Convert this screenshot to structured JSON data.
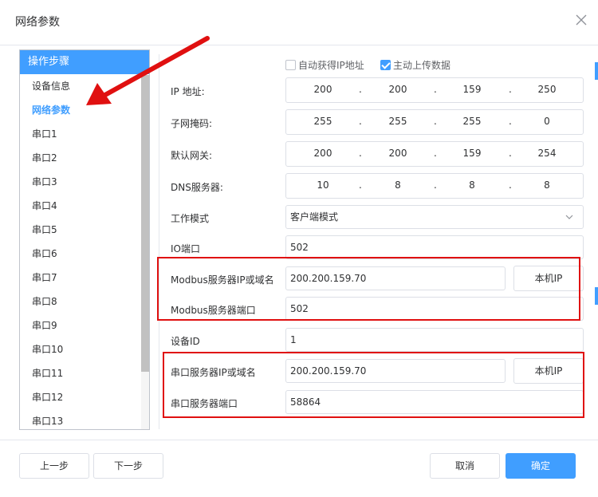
{
  "dialog": {
    "title": "网络参数"
  },
  "steps": {
    "header": "操作步骤",
    "items": [
      "设备信息",
      "网络参数",
      "串口1",
      "串口2",
      "串口3",
      "串口4",
      "串口5",
      "串口6",
      "串口7",
      "串口8",
      "串口9",
      "串口10",
      "串口11",
      "串口12",
      "串口13"
    ],
    "active": "网络参数"
  },
  "options": {
    "auto_ip_label": "自动获得IP地址",
    "auto_ip_checked": false,
    "upload_label": "主动上传数据",
    "upload_checked": true
  },
  "fields": {
    "ip_label": "IP 地址:",
    "ip": [
      "200",
      "200",
      "159",
      "250"
    ],
    "mask_label": "子网掩码:",
    "mask": [
      "255",
      "255",
      "255",
      "0"
    ],
    "gateway_label": "默认网关:",
    "gateway": [
      "200",
      "200",
      "159",
      "254"
    ],
    "dns_label": "DNS服务器:",
    "dns": [
      "10",
      "8",
      "8",
      "8"
    ],
    "mode_label": "工作模式",
    "mode_value": "客户端模式",
    "io_port_label": "IO端口",
    "io_port": "502",
    "modbus_host_label": "Modbus服务器IP或域名",
    "modbus_host": "200.200.159.70",
    "modbus_local_ip_btn": "本机IP",
    "modbus_port_label": "Modbus服务器端口",
    "modbus_port": "502",
    "device_id_label": "设备ID",
    "device_id": "1",
    "serial_host_label": "串口服务器IP或域名",
    "serial_host": "200.200.159.70",
    "serial_local_ip_btn": "本机IP",
    "serial_port_label": "串口服务器端口",
    "serial_port": "58864"
  },
  "footer": {
    "prev": "上一步",
    "next": "下一步",
    "cancel": "取消",
    "confirm": "确定"
  },
  "colors": {
    "accent": "#409eff",
    "annotation": "#e01010"
  },
  "icons": {
    "close": "close-icon",
    "arrow": "annotation-arrow",
    "chevron": "chevron-down-icon"
  }
}
